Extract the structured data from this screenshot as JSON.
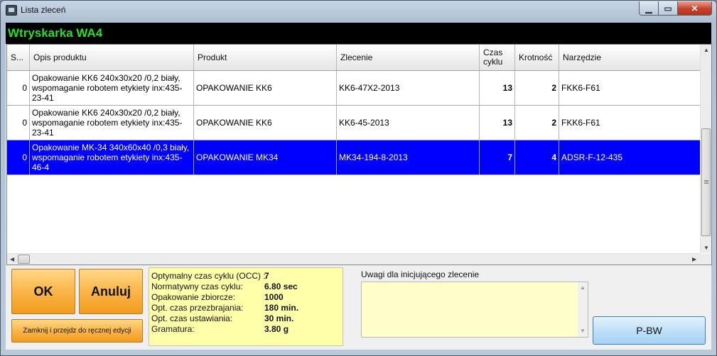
{
  "window": {
    "title": "Lista zleceń"
  },
  "banner": {
    "machine": "Wtryskarka WA4"
  },
  "table": {
    "columns": [
      "S...",
      "Opis produktu",
      "Produkt",
      "Zlecenie",
      "Czas cyklu",
      "Krotność",
      "Narzędzie"
    ],
    "rows": [
      {
        "s": "0",
        "opis": "Opakowanie KK6 240x30x20 /0,2 biały, wspomaganie robotem etykiety inx:435-23-41",
        "produkt": "OPAKOWANIE KK6",
        "zlecenie": "KK6-47X2-2013",
        "czas": "13",
        "krotnosc": "2",
        "narzedzie": "FKK6-F61"
      },
      {
        "s": "0",
        "opis": "Opakowanie KK6 240x30x20 /0,2 biały, wspomaganie robotem etykiety inx:435-23-41",
        "produkt": "OPAKOWANIE KK6",
        "zlecenie": "KK6-45-2013",
        "czas": "13",
        "krotnosc": "2",
        "narzedzie": "FKK6-F61"
      },
      {
        "s": "0",
        "opis": "Opakowanie MK-34 340x60x40 /0,3 biały, wspomaganie robotem etykiety inx:435-46-4",
        "produkt": "OPAKOWANIE MK34",
        "zlecenie": "MK34-194-8-2013",
        "czas": "7",
        "krotnosc": "4",
        "narzedzie": "ADSR-F-12-435",
        "selected": true
      }
    ]
  },
  "buttons": {
    "ok": "OK",
    "cancel": "Anuluj",
    "close_edit": "Zamknij i przejdz do ręcznej edycji",
    "pbw": "P-BW"
  },
  "info": {
    "items": [
      {
        "label": "Optymalny czas cyklu (OCC) :",
        "value": "7"
      },
      {
        "label": "Normatywny czas cyklu:",
        "value": "6.80 sec"
      },
      {
        "label": "Opakowanie zbiorcze:",
        "value": "1000"
      },
      {
        "label": "Opt. czas przezbrajania:",
        "value": "180 min."
      },
      {
        "label": "Opt. czas ustawiania:",
        "value": "30 min."
      },
      {
        "label": "Gramatura:",
        "value": "3.80 g"
      }
    ]
  },
  "notes": {
    "label": "Uwagi dla inicjującego zlecenie",
    "value": ""
  },
  "colors": {
    "banner_text": "#27e027",
    "selection": "#0000ff",
    "info_bg": "#ffffaa",
    "button_orange": "#fab548"
  }
}
